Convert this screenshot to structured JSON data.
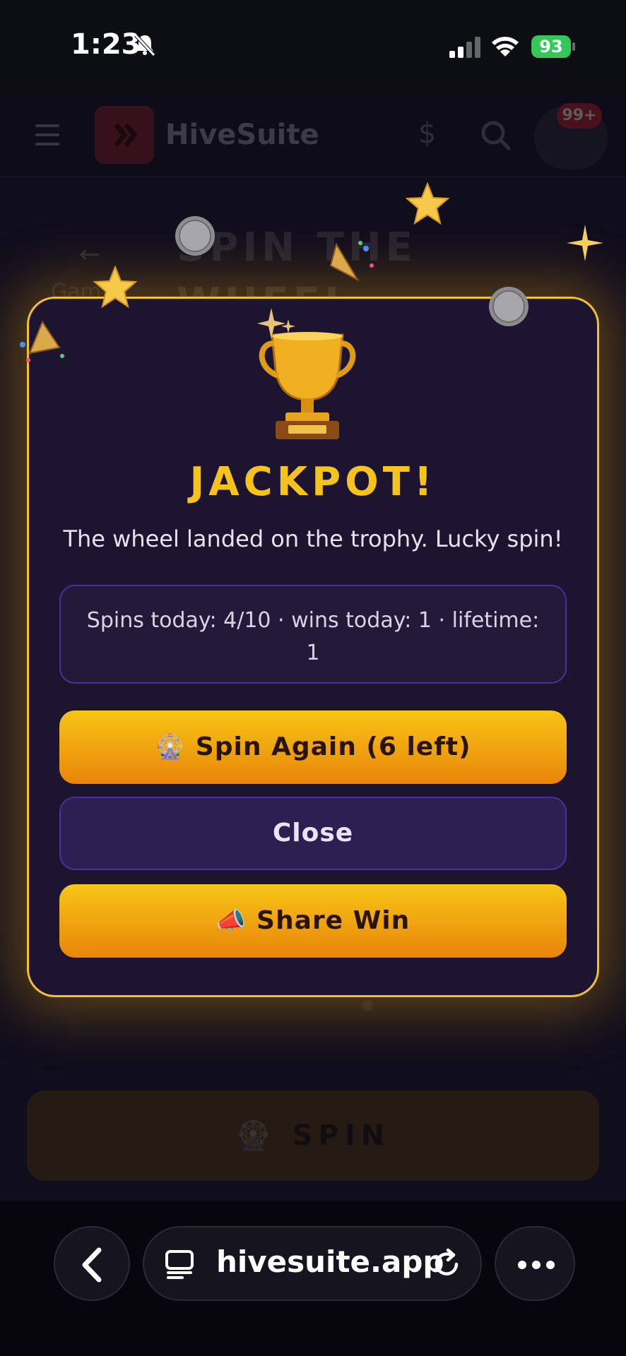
{
  "status_bar": {
    "time": "1:23",
    "battery": "93"
  },
  "app_header": {
    "app_name": "HiveSuite",
    "currency_symbol": "$",
    "notification_badge": "99+"
  },
  "page_background": {
    "title_line1": "SPIN THE",
    "title_line2": "WHEEL",
    "breadcrumb": "Gam",
    "spin_button": "SPIN"
  },
  "modal": {
    "title": "JACKPOT!",
    "message": "The wheel landed on the trophy. Lucky spin!",
    "stats": "Spins today: 4/10 · wins today: 1 · lifetime: 1",
    "spin_again_emoji": "🎡",
    "spin_again_label": "Spin Again (6 left)",
    "close_label": "Close",
    "share_emoji": "📣",
    "share_label": "Share Win"
  },
  "browser": {
    "url": "hivesuite.app"
  },
  "colors": {
    "accent_gold": "#f6c21c",
    "modal_border": "#f2c12e",
    "modal_bg": "#1d1530",
    "purple_border": "#4b2fa0"
  }
}
